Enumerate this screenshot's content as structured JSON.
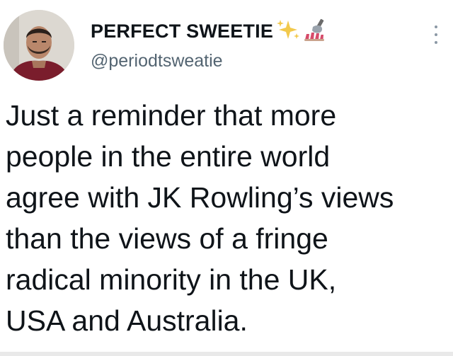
{
  "tweet": {
    "author": {
      "display_name": "PERFECT SWEETIE",
      "handle": "@periodtsweatie",
      "emojis": [
        "sparkles-emoji",
        "nail-polish-emoji"
      ]
    },
    "body_lines": [
      "Just a reminder that more",
      "people in the entire world",
      "agree with JK Rowling’s views",
      "than the views of a fringe",
      "radical minority in the UK,",
      "USA and Australia."
    ]
  },
  "colors": {
    "text": "#0f1419",
    "secondary_text": "#536471",
    "sparkle": "#f2c94c",
    "nail_polish": "#d64b6a"
  },
  "icons": {
    "more": "more-options-icon"
  }
}
